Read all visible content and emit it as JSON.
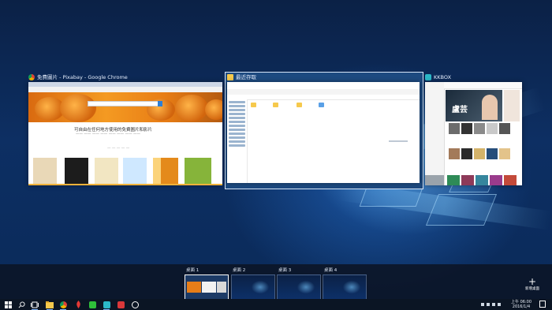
{
  "windows": {
    "chrome": {
      "title": "免費圖片 - Pixabay - Google Chrome",
      "headline": "可自由在任何地方使用的免費圖片和影片",
      "icon": "chrome-icon"
    },
    "explorer": {
      "title": "最近存取",
      "icon": "folder-icon"
    },
    "kkbox": {
      "title": "KKBOX",
      "icon": "kkbox-icon",
      "banner_text": "盧芸"
    }
  },
  "virtual_desktops": [
    {
      "label": "桌面 1",
      "active": true
    },
    {
      "label": "桌面 2",
      "active": false
    },
    {
      "label": "桌面 3",
      "active": false
    },
    {
      "label": "桌面 4",
      "active": false
    }
  ],
  "new_desktop_label": "新增桌面",
  "taskbar": {
    "clock_time": "上午 06:00",
    "clock_date": "2016/1/4",
    "icons": [
      "windows-start-icon",
      "search-icon",
      "task-view-icon",
      "file-explorer-icon",
      "chrome-icon",
      "app-icon",
      "line-icon",
      "kkbox-icon",
      "app-icon",
      "game-icon"
    ]
  },
  "colors": {
    "accent": "#2c7fd6",
    "taskbar": "#0b1524",
    "desktop": "#0b2146"
  }
}
